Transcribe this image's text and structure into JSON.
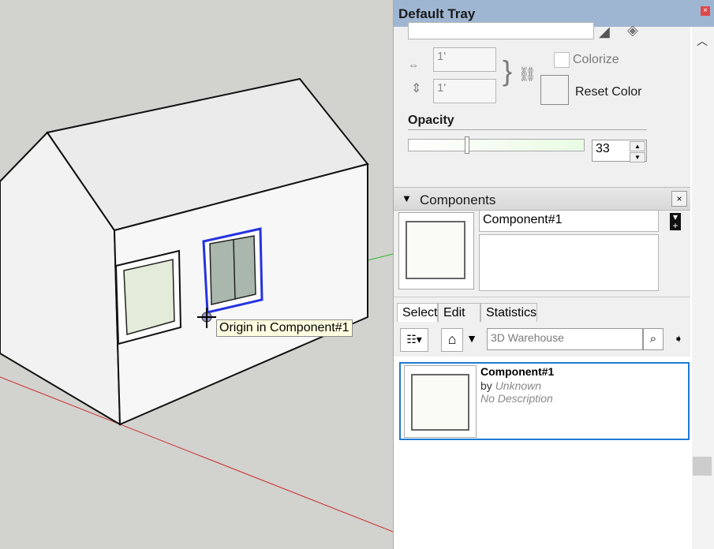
{
  "viewport": {
    "tooltip": "Origin in Component#1"
  },
  "tray": {
    "title": "Default Tray"
  },
  "materials": {
    "width_value": "1'",
    "height_value": "1'",
    "colorize_label": "Colorize",
    "reset_color_label": "Reset Color",
    "opacity_label": "Opacity",
    "opacity_value": "33",
    "opacity_fraction": 0.33
  },
  "components": {
    "header": "Components",
    "name_value": "Component#1",
    "tabs": [
      {
        "label": "Select",
        "active": true
      },
      {
        "label": "Edit",
        "active": false
      },
      {
        "label": "Statistics",
        "active": false
      }
    ],
    "search_placeholder": "3D Warehouse",
    "item": {
      "name": "Component#1",
      "by_prefix": "by",
      "author": "Unknown",
      "description": "No Description"
    }
  },
  "colors": {
    "selection": "#1f7ad2",
    "tray_title_bg": "#9fb6d3",
    "axis_red": "#cc2a2a",
    "axis_green": "#2bbd2b"
  }
}
